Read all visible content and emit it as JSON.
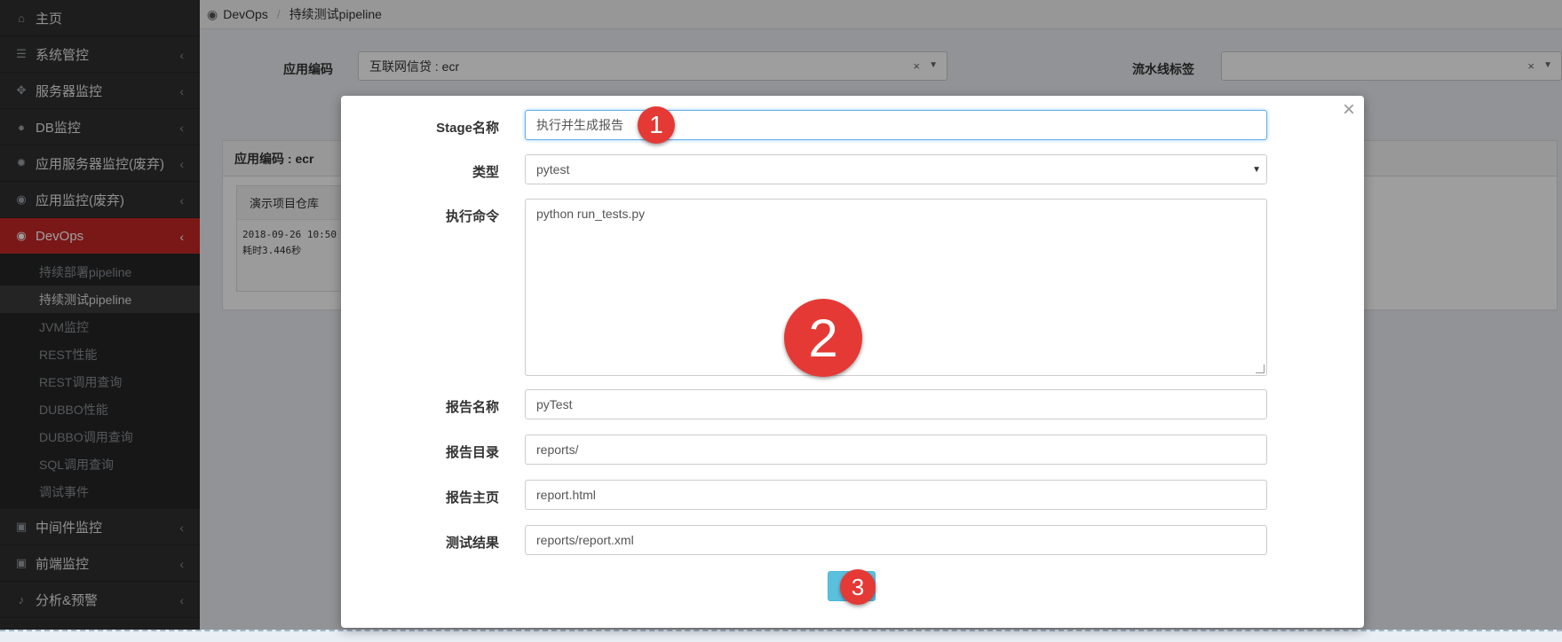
{
  "sidebar": {
    "items": [
      {
        "label": "主页",
        "icon": "home-icon"
      },
      {
        "label": "系统管控",
        "icon": "server-icon"
      },
      {
        "label": "服务器监控",
        "icon": "crosshair-icon"
      },
      {
        "label": "DB监控",
        "icon": "globe-icon"
      },
      {
        "label": "应用服务器监控(废弃)",
        "icon": "gear-icon"
      },
      {
        "label": "应用监控(废弃)",
        "icon": "eye-icon"
      },
      {
        "label": "DevOps",
        "icon": "eye-icon"
      }
    ],
    "sub_items": [
      "持续部署pipeline",
      "持续测试pipeline",
      "JVM监控",
      "REST性能",
      "REST调用查询",
      "DUBBO性能",
      "DUBBO调用查询",
      "SQL调用查询",
      "调试事件"
    ],
    "bottom_items": [
      {
        "label": "中间件监控",
        "icon": "briefcase-icon"
      },
      {
        "label": "前端监控",
        "icon": "briefcase-icon"
      },
      {
        "label": "分析&预警",
        "icon": "bell-icon"
      }
    ],
    "chevron": "‹"
  },
  "breadcrumb": {
    "root": "DevOps",
    "separator": "/",
    "current": "持续测试pipeline"
  },
  "filters": {
    "app_code_label": "应用编码",
    "app_code_value": "互联网信贷 : ecr",
    "pipeline_tag_label": "流水线标签",
    "pipeline_tag_value": "",
    "clear": "×"
  },
  "panel": {
    "title": "应用编码 : ecr",
    "card_title": "演示项目仓库",
    "card_line1": "2018-09-26 10:50",
    "card_line2": "耗时3.446秒"
  },
  "modal": {
    "close": "×",
    "stage_name_label": "Stage名称",
    "stage_name_value": "执行并生成报告",
    "type_label": "类型",
    "type_value": "pytest",
    "command_label": "执行命令",
    "command_value": "python run_tests.py",
    "report_name_label": "报告名称",
    "report_name_value": "pyTest",
    "report_dir_label": "报告目录",
    "report_dir_value": "reports/",
    "report_home_label": "报告主页",
    "report_home_value": "report.html",
    "test_result_label": "测试结果",
    "test_result_value": "reports/report.xml"
  },
  "annotations": [
    "1",
    "2",
    "3"
  ],
  "colors": {
    "active_nav": "#c62828",
    "badge": "#e53935",
    "submit": "#5bc0de",
    "focus": "#66afe9"
  }
}
